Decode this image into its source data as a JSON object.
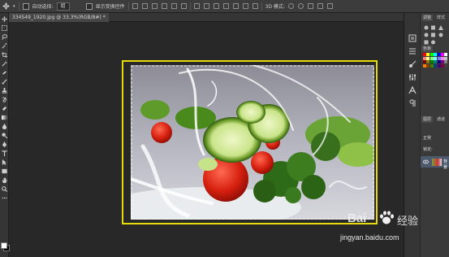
{
  "options_bar": {
    "auto_select_label": "自动选择:",
    "auto_select_value": "组",
    "show_transform_label": "显示变换控件",
    "mode_3d_label": "3D 模式:"
  },
  "document": {
    "tab_title": "334549_1920.jpg @ 33.3%(RGB/8#) *"
  },
  "panels": {
    "adjust_tab": "调整",
    "style_tab": "样式",
    "swatches_tab": "色板",
    "layers_tab": "图层",
    "channels_tab": "通道",
    "layers_filter": "正常",
    "lock_label": "锁定:",
    "layer_name": "背景"
  },
  "watermark": {
    "brand": "Bai",
    "brand_tail": "经验",
    "url": "jingyan.baidu.com"
  },
  "colors": {
    "selection_frame": "#e6dc0c",
    "foreground": "#ffffff",
    "background": "#000000",
    "workspace": "#282828"
  },
  "swatch_colors": [
    "#ff0000",
    "#ffff00",
    "#00ff00",
    "#00ffff",
    "#0000ff",
    "#ff00ff",
    "#ffffff",
    "#ff8080",
    "#ffff80",
    "#80ff80",
    "#80ffff",
    "#8080ff",
    "#ff80ff",
    "#c0c0c0",
    "#800000",
    "#808000",
    "#008000",
    "#008080",
    "#000080",
    "#800080",
    "#808080",
    "#ff8000",
    "#804000",
    "#408000",
    "#004080",
    "#400080",
    "#800040",
    "#404040"
  ]
}
